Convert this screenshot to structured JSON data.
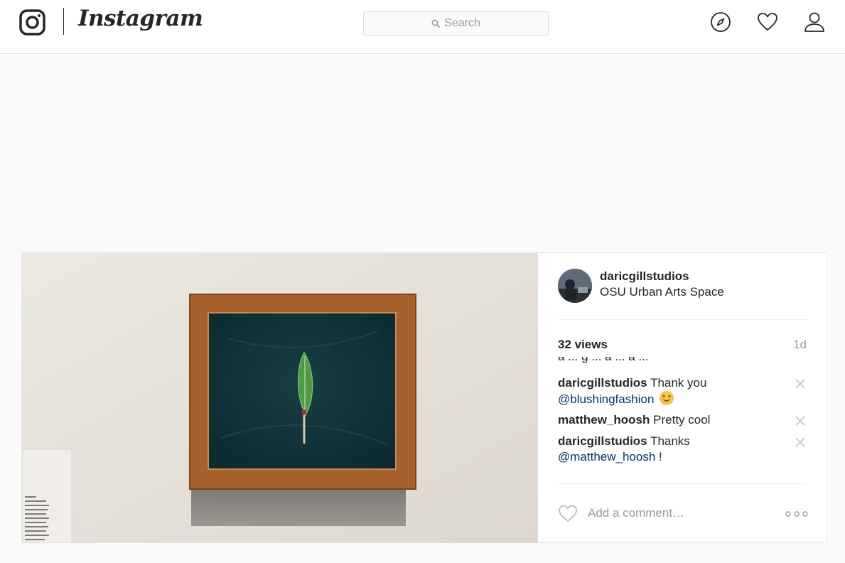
{
  "header": {
    "brand": "Instagram",
    "search_placeholder": "Search"
  },
  "post": {
    "username": "daricgillstudios",
    "location": "OSU Urban Arts Space",
    "views": "32 views",
    "time_ago": "1d",
    "clipped_comment_fragment": "a ... g ... a ... a ...",
    "comments": [
      {
        "user": "daricgillstudios",
        "text": "Thank you",
        "mention": "@blushingfashion",
        "suffix": ""
      },
      {
        "user": "matthew_hoosh",
        "text": "Pretty cool",
        "mention": "",
        "suffix": ""
      },
      {
        "user": "daricgillstudios",
        "text": "Thanks",
        "mention": "@matthew_hoosh",
        "suffix": " !"
      }
    ],
    "add_comment_placeholder": "Add a comment…"
  },
  "colors": {
    "link": "#003569",
    "muted": "#999999",
    "border": "#dbdbdb",
    "background": "#fafafa"
  }
}
